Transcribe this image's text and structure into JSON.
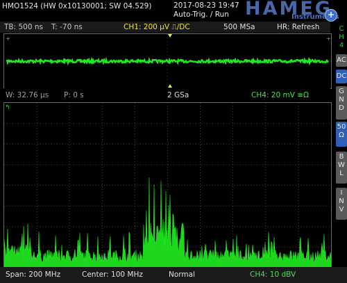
{
  "header": {
    "device_info": "HMO1524 (HW 0x10130001; SW 04.529)",
    "datetime": "2017-08-23 19:47",
    "trigger_mode": "Auto-Trig. / Run",
    "logo": "HAMEG",
    "logo_sub": "Instruments",
    "zoom_icon": "magnifier-plus-icon"
  },
  "status": {
    "timebase": "TB: 500 ns",
    "trigger_time": "T: -70 ns",
    "ch1": "CH1: 200 µV ⎍/DC",
    "sample_rate": "500 MSa",
    "hr": "HR: Refresh"
  },
  "side_panel": {
    "ch_label": "CH4",
    "buttons": [
      {
        "label": "AC",
        "active": false
      },
      {
        "label": "DC",
        "active": true
      },
      {
        "label": "GND",
        "active": false
      },
      {
        "label": "50 Ω",
        "active": true
      },
      {
        "label": "BWL",
        "active": false
      },
      {
        "label": "INV",
        "active": false
      }
    ]
  },
  "mid": {
    "window": "W: 32.76 µs",
    "position": "P: 0 s",
    "fft_rate": "2 GSa",
    "ch4": "CH4: 20 mV ≅Ω"
  },
  "bottom": {
    "span": "Span: 200 MHz",
    "center": "Center: 100 MHz",
    "mode": "Normal",
    "ch4_scale": "CH4: 10 dBV"
  },
  "colors": {
    "trace": "#22e622",
    "ch1": "#f4e626",
    "grid": "#5a5a5a",
    "logo": "#4a68a8"
  }
}
